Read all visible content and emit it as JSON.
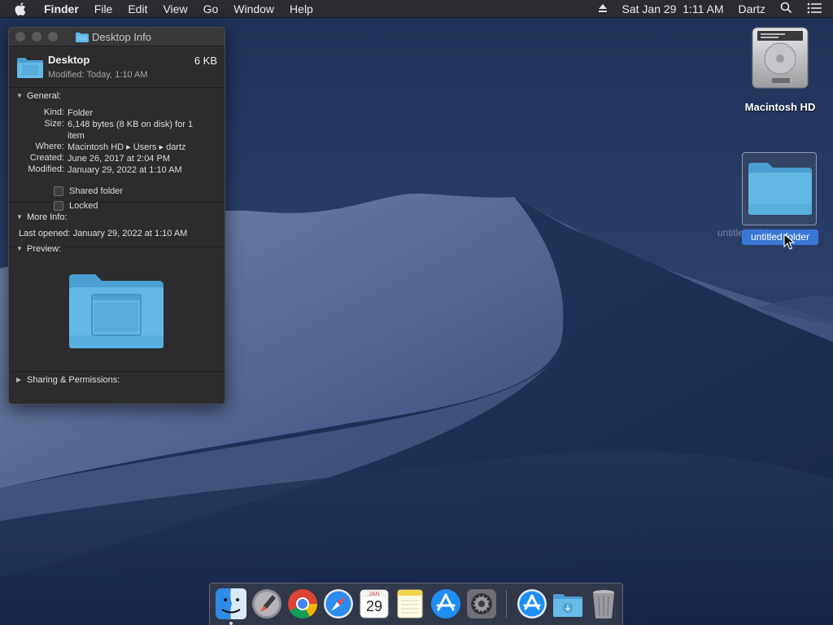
{
  "menubar": {
    "app_name": "Finder",
    "items": [
      "File",
      "Edit",
      "View",
      "Go",
      "Window",
      "Help"
    ],
    "datetime": "Sat Jan 29  1:11 AM",
    "user": "Dartz",
    "icons": [
      "apple-icon",
      "eject-icon",
      "spotlight-search-icon",
      "notification-center-icon"
    ]
  },
  "info_window": {
    "title": "Desktop Info",
    "item_name": "Desktop",
    "item_size": "6 KB",
    "modified_short": "Modified: Today, 1:10 AM",
    "general": {
      "header": "General:",
      "kind_label": "Kind:",
      "kind_value": "Folder",
      "size_label": "Size:",
      "size_value": "6,148 bytes (8 KB on disk) for 1 item",
      "where_label": "Where:",
      "where_value": "Macintosh HD ▸ Users ▸ dartz",
      "created_label": "Created:",
      "created_value": "June 26, 2017 at 2:04 PM",
      "modified_label": "Modified:",
      "modified_value": "January 29, 2022 at 1:10 AM",
      "shared_folder": "Shared folder",
      "locked": "Locked"
    },
    "more_info": {
      "header": "More Info:",
      "last_opened_label": "Last opened:",
      "last_opened_value": "January 29, 2022 at 1:10 AM"
    },
    "preview": {
      "header": "Preview:"
    },
    "sharing": {
      "header": "Sharing & Permissions:"
    }
  },
  "desktop": {
    "hd_label": "Macintosh HD",
    "folder_label": "untitled folder",
    "ghost_label": "untitled folder"
  },
  "dock": {
    "items": [
      "finder-icon",
      "launchpad-icon",
      "chrome-icon",
      "safari-icon",
      "calendar-icon",
      "notes-icon",
      "app-store-icon",
      "system-preferences-icon",
      "app-store-downloads-icon",
      "downloads-folder-icon",
      "trash-icon"
    ],
    "calendar_month": "JAN",
    "calendar_day": "29"
  },
  "colors": {
    "menubar": "#2b2c31",
    "window_bg": "#2c2c2e",
    "selection": "#3a78d5",
    "folder_blue": "#5fb7e6"
  }
}
